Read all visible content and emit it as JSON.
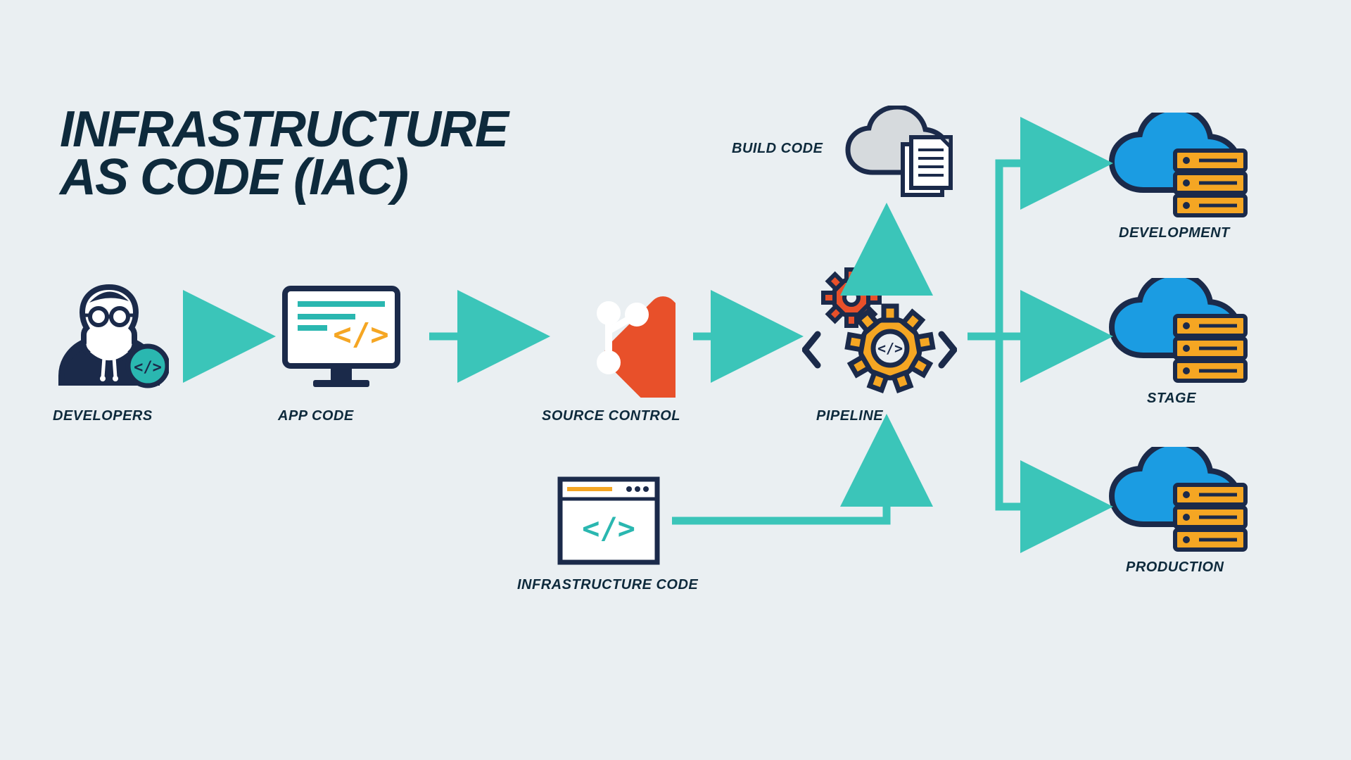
{
  "title_line1": "INFRASTRUCTURE",
  "title_line2": "AS CODE (IAC)",
  "nodes": {
    "developers": "DEVELOPERS",
    "app_code": "APP CODE",
    "source_control": "SOURCE CONTROL",
    "pipeline": "PIPELINE",
    "build_code": "BUILD CODE",
    "infrastructure_code": "INFRASTRUCTURE CODE",
    "development": "DEVELOPMENT",
    "stage": "STAGE",
    "production": "PRODUCTION"
  },
  "colors": {
    "background": "#eaeff2",
    "text": "#0e2a3c",
    "arrow": "#3bc5b9",
    "orange": "#f5a623",
    "red_orange": "#e8502a",
    "blue": "#1b9ce2",
    "navy": "#1b2a4a",
    "teal": "#2ab7b0",
    "light_gray": "#d6dadd"
  }
}
